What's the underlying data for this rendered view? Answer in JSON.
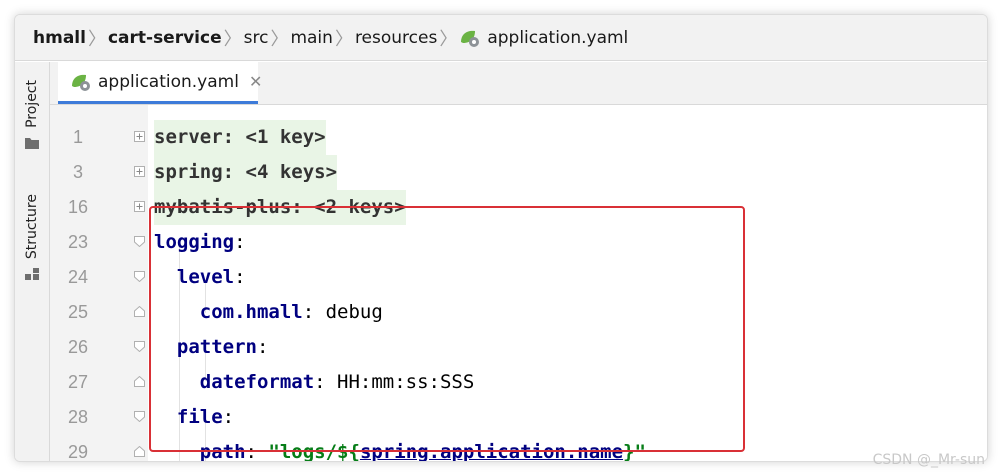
{
  "breadcrumb": {
    "items": [
      {
        "label": "hmall",
        "bold": true
      },
      {
        "label": "cart-service",
        "bold": true
      },
      {
        "label": "src",
        "bold": false
      },
      {
        "label": "main",
        "bold": false
      },
      {
        "label": "resources",
        "bold": false
      }
    ],
    "file": "application.yaml"
  },
  "side_tabs": {
    "project": "Project",
    "structure": "Structure"
  },
  "editor_tab": {
    "label": "application.yaml",
    "close": "✕"
  },
  "lines": [
    {
      "num": "1",
      "key": "server",
      "suffix": "<1 key>"
    },
    {
      "num": "3",
      "key": "spring",
      "suffix": "<4 keys>"
    },
    {
      "num": "16",
      "key": "mybatis-plus",
      "suffix": "<2 keys>"
    },
    {
      "num": "23",
      "key": "logging"
    },
    {
      "num": "24",
      "key": "level"
    },
    {
      "num": "25",
      "key": "com.hmall",
      "value": "debug"
    },
    {
      "num": "26",
      "key": "pattern"
    },
    {
      "num": "27",
      "key": "dateformat",
      "value": "HH:mm:ss:SSS"
    },
    {
      "num": "28",
      "key": "file"
    },
    {
      "num": "29",
      "key": "path",
      "value_prefix": "\"logs/${",
      "value_placeholder": "spring.application.name",
      "value_suffix": "}\""
    }
  ],
  "watermark": "CSDN @_Mr-sun",
  "colors": {
    "key": "#000080",
    "string": "#067d17",
    "highlight_box": "#d93036",
    "tab_underline": "#3d7bd9",
    "folded_bg": "#e9f5e6"
  }
}
